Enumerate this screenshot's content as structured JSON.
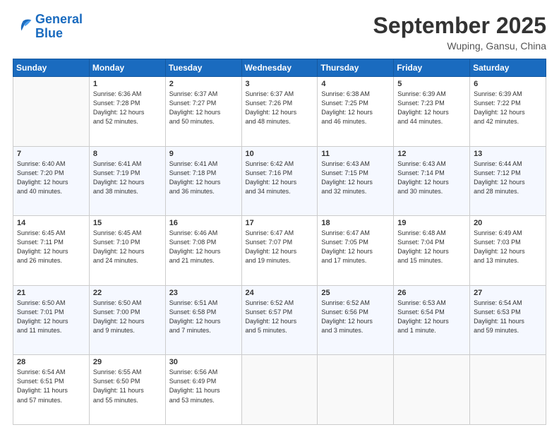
{
  "header": {
    "logo_line1": "General",
    "logo_line2": "Blue",
    "month": "September 2025",
    "location": "Wuping, Gansu, China"
  },
  "weekdays": [
    "Sunday",
    "Monday",
    "Tuesday",
    "Wednesday",
    "Thursday",
    "Friday",
    "Saturday"
  ],
  "weeks": [
    [
      {
        "day": "",
        "info": ""
      },
      {
        "day": "1",
        "info": "Sunrise: 6:36 AM\nSunset: 7:28 PM\nDaylight: 12 hours\nand 52 minutes."
      },
      {
        "day": "2",
        "info": "Sunrise: 6:37 AM\nSunset: 7:27 PM\nDaylight: 12 hours\nand 50 minutes."
      },
      {
        "day": "3",
        "info": "Sunrise: 6:37 AM\nSunset: 7:26 PM\nDaylight: 12 hours\nand 48 minutes."
      },
      {
        "day": "4",
        "info": "Sunrise: 6:38 AM\nSunset: 7:25 PM\nDaylight: 12 hours\nand 46 minutes."
      },
      {
        "day": "5",
        "info": "Sunrise: 6:39 AM\nSunset: 7:23 PM\nDaylight: 12 hours\nand 44 minutes."
      },
      {
        "day": "6",
        "info": "Sunrise: 6:39 AM\nSunset: 7:22 PM\nDaylight: 12 hours\nand 42 minutes."
      }
    ],
    [
      {
        "day": "7",
        "info": "Sunrise: 6:40 AM\nSunset: 7:20 PM\nDaylight: 12 hours\nand 40 minutes."
      },
      {
        "day": "8",
        "info": "Sunrise: 6:41 AM\nSunset: 7:19 PM\nDaylight: 12 hours\nand 38 minutes."
      },
      {
        "day": "9",
        "info": "Sunrise: 6:41 AM\nSunset: 7:18 PM\nDaylight: 12 hours\nand 36 minutes."
      },
      {
        "day": "10",
        "info": "Sunrise: 6:42 AM\nSunset: 7:16 PM\nDaylight: 12 hours\nand 34 minutes."
      },
      {
        "day": "11",
        "info": "Sunrise: 6:43 AM\nSunset: 7:15 PM\nDaylight: 12 hours\nand 32 minutes."
      },
      {
        "day": "12",
        "info": "Sunrise: 6:43 AM\nSunset: 7:14 PM\nDaylight: 12 hours\nand 30 minutes."
      },
      {
        "day": "13",
        "info": "Sunrise: 6:44 AM\nSunset: 7:12 PM\nDaylight: 12 hours\nand 28 minutes."
      }
    ],
    [
      {
        "day": "14",
        "info": "Sunrise: 6:45 AM\nSunset: 7:11 PM\nDaylight: 12 hours\nand 26 minutes."
      },
      {
        "day": "15",
        "info": "Sunrise: 6:45 AM\nSunset: 7:10 PM\nDaylight: 12 hours\nand 24 minutes."
      },
      {
        "day": "16",
        "info": "Sunrise: 6:46 AM\nSunset: 7:08 PM\nDaylight: 12 hours\nand 21 minutes."
      },
      {
        "day": "17",
        "info": "Sunrise: 6:47 AM\nSunset: 7:07 PM\nDaylight: 12 hours\nand 19 minutes."
      },
      {
        "day": "18",
        "info": "Sunrise: 6:47 AM\nSunset: 7:05 PM\nDaylight: 12 hours\nand 17 minutes."
      },
      {
        "day": "19",
        "info": "Sunrise: 6:48 AM\nSunset: 7:04 PM\nDaylight: 12 hours\nand 15 minutes."
      },
      {
        "day": "20",
        "info": "Sunrise: 6:49 AM\nSunset: 7:03 PM\nDaylight: 12 hours\nand 13 minutes."
      }
    ],
    [
      {
        "day": "21",
        "info": "Sunrise: 6:50 AM\nSunset: 7:01 PM\nDaylight: 12 hours\nand 11 minutes."
      },
      {
        "day": "22",
        "info": "Sunrise: 6:50 AM\nSunset: 7:00 PM\nDaylight: 12 hours\nand 9 minutes."
      },
      {
        "day": "23",
        "info": "Sunrise: 6:51 AM\nSunset: 6:58 PM\nDaylight: 12 hours\nand 7 minutes."
      },
      {
        "day": "24",
        "info": "Sunrise: 6:52 AM\nSunset: 6:57 PM\nDaylight: 12 hours\nand 5 minutes."
      },
      {
        "day": "25",
        "info": "Sunrise: 6:52 AM\nSunset: 6:56 PM\nDaylight: 12 hours\nand 3 minutes."
      },
      {
        "day": "26",
        "info": "Sunrise: 6:53 AM\nSunset: 6:54 PM\nDaylight: 12 hours\nand 1 minute."
      },
      {
        "day": "27",
        "info": "Sunrise: 6:54 AM\nSunset: 6:53 PM\nDaylight: 11 hours\nand 59 minutes."
      }
    ],
    [
      {
        "day": "28",
        "info": "Sunrise: 6:54 AM\nSunset: 6:51 PM\nDaylight: 11 hours\nand 57 minutes."
      },
      {
        "day": "29",
        "info": "Sunrise: 6:55 AM\nSunset: 6:50 PM\nDaylight: 11 hours\nand 55 minutes."
      },
      {
        "day": "30",
        "info": "Sunrise: 6:56 AM\nSunset: 6:49 PM\nDaylight: 11 hours\nand 53 minutes."
      },
      {
        "day": "",
        "info": ""
      },
      {
        "day": "",
        "info": ""
      },
      {
        "day": "",
        "info": ""
      },
      {
        "day": "",
        "info": ""
      }
    ]
  ]
}
